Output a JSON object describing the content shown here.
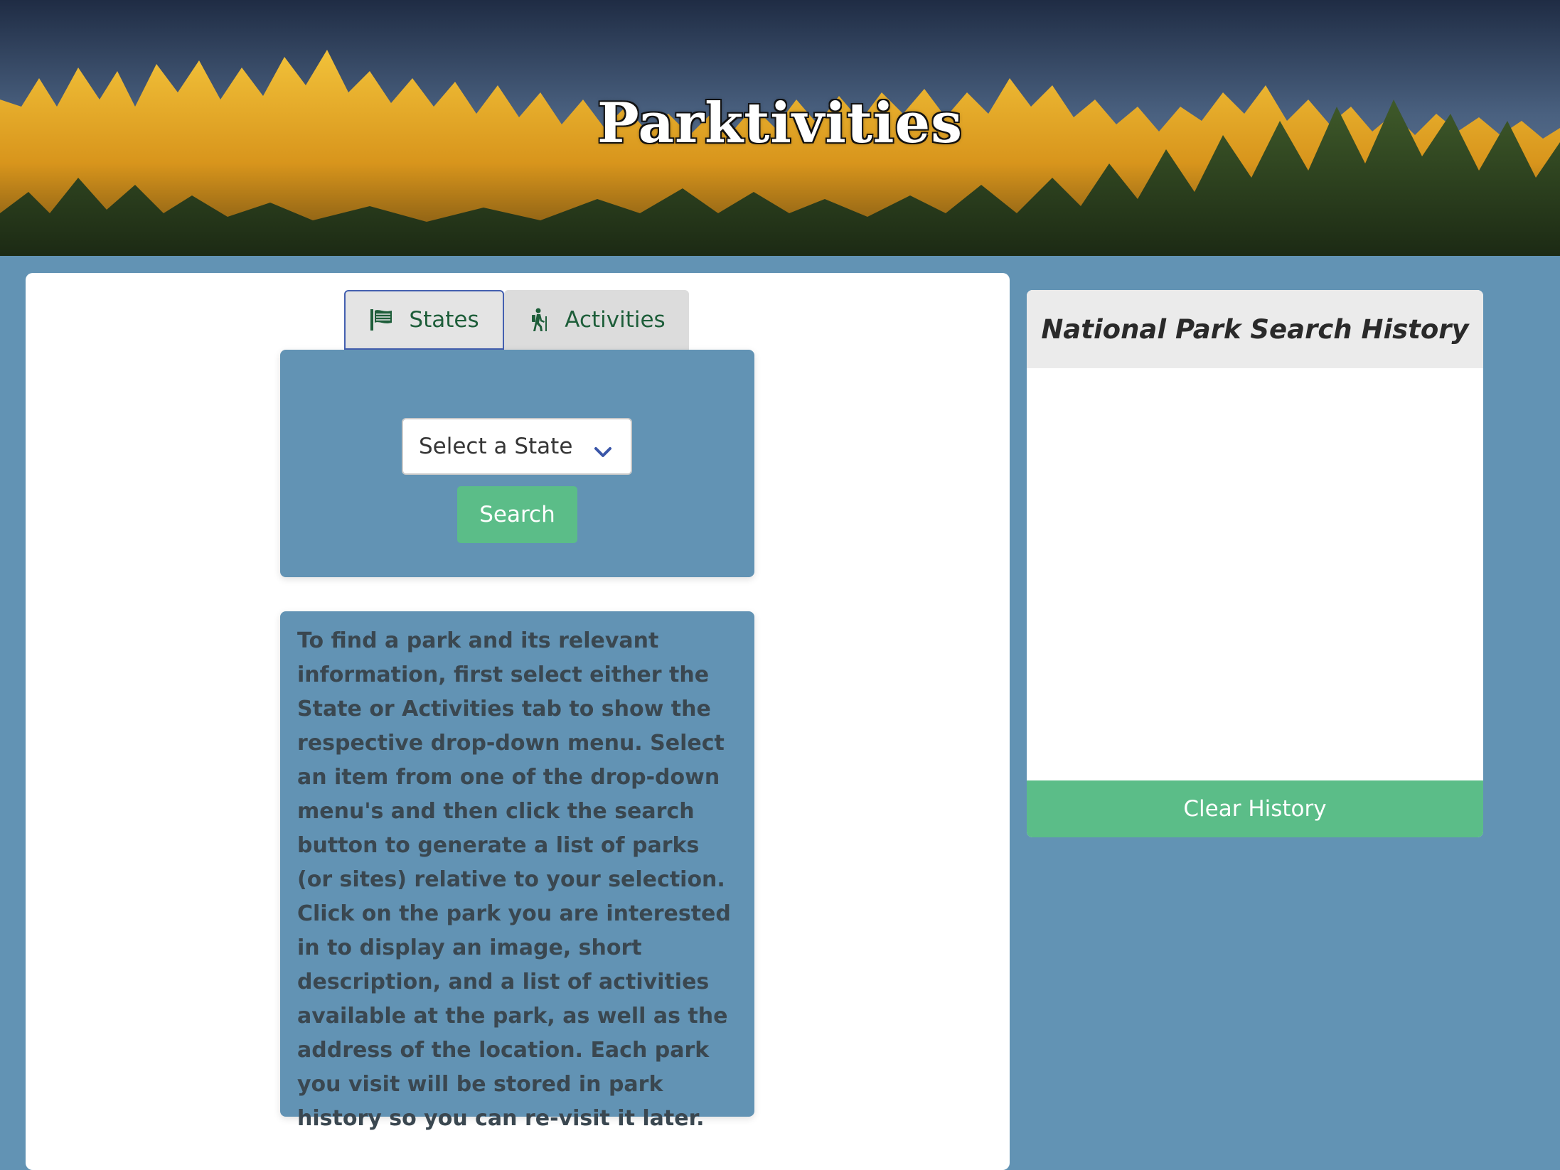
{
  "header": {
    "title": "Parktivities"
  },
  "tabs": [
    {
      "label": "States",
      "icon": "flag-icon",
      "active": true
    },
    {
      "label": "Activities",
      "icon": "hiking-icon",
      "active": false
    }
  ],
  "search": {
    "select_value": "Select a State",
    "button_label": "Search"
  },
  "info": {
    "text": "To find a park and its relevant information, first select either the State or Activities tab to show the respective drop-down menu. Select an item from one of the drop-down menu's and then click the search button to generate a list of parks (or sites) relative to your selection. Click on the park you are interested in to display an image, short description, and a list of activities available at the park, as well as the address of the location. Each park you visit will be stored in park history so you can re-visit it later."
  },
  "history": {
    "title": "National Park Search History",
    "items": [],
    "clear_label": "Clear History"
  },
  "colors": {
    "page_background": "#6293b4",
    "accent_green": "#5bbd88",
    "tab_text": "#1e5e3a",
    "active_tab_border": "#4460b0"
  }
}
